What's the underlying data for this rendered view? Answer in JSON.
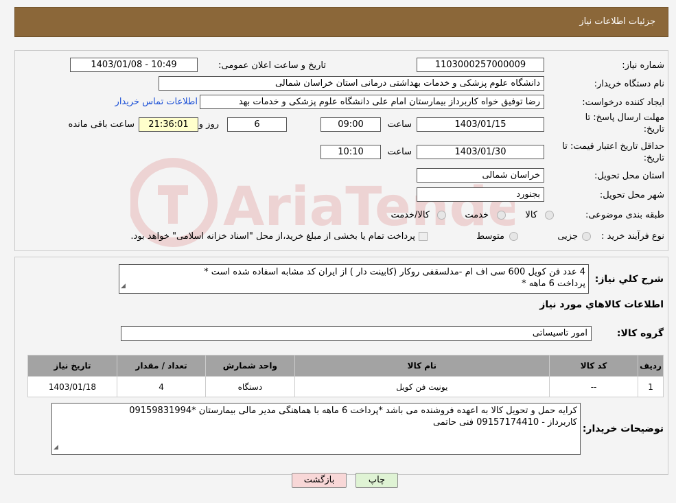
{
  "header": {
    "title": "جزئیات اطلاعات نیاز"
  },
  "form": {
    "need_number_label": "شماره نیاز:",
    "need_number": "1103000257000009",
    "announce_label": "تاریخ و ساعت اعلان عمومی:",
    "announce_value": "1403/01/08 - 10:49",
    "buyer_label": "نام دستگاه خریدار:",
    "buyer_value": "دانشگاه علوم پزشکی و خدمات بهداشتی درمانی استان خراسان شمالی",
    "creator_label": "ایجاد کننده درخواست:",
    "creator_value": "رضا توفیق خواه کاربرداز بیمارستان امام علی دانشگاه علوم پزشکی و خدمات بهد",
    "contact_link": "اطلاعات تماس خریدار",
    "deadline_label_1": "مهلت ارسال پاسخ: تا",
    "deadline_label_2": "تاریخ:",
    "deadline_date": "1403/01/15",
    "time_label": "ساعت",
    "deadline_time": "09:00",
    "days_value": "6",
    "days_label": "روز و",
    "remaining_time": "21:36:01",
    "remaining_label": "ساعت باقی مانده",
    "validity_label_1": "حداقل تاریخ اعتبار قیمت: تا",
    "validity_label_2": "تاریخ:",
    "validity_date": "1403/01/30",
    "validity_time": "10:10",
    "province_label": "استان محل تحویل:",
    "province_value": "خراسان شمالی",
    "city_label": "شهر محل تحویل:",
    "city_value": "بجنورد",
    "category_label": "طبقه بندی موضوعی:",
    "category_options": [
      "کالا",
      "خدمت",
      "کالا/خدمت"
    ],
    "process_label": "نوع فرآیند خرید :",
    "process_options": [
      "جزیی",
      "متوسط"
    ],
    "process_note": "پرداخت تمام یا بخشی از مبلغ خرید،از محل \"اسناد خزانه اسلامی\" خواهد بود."
  },
  "summary": {
    "label": "شرح کلي نياز:",
    "line1": "4 عدد فن کویل 600 سی اف ام -مدلسقفی روکار (کابینت دار ) از ایران کد مشابه اسفاده شده است *",
    "line2": "پرداخت 6  ماهه *"
  },
  "items_section": {
    "title": "اطلاعات کالاهاي مورد نياز",
    "group_label": "گروه کالا:",
    "group_value": "امور تاسیساتی",
    "headers": [
      "ردیف",
      "کد کالا",
      "نام کالا",
      "واحد شمارش",
      "تعداد / مقدار",
      "تاریخ نیاز"
    ],
    "rows": [
      [
        "1",
        "--",
        "یونیت فن کویل",
        "دستگاه",
        "4",
        "1403/01/18"
      ]
    ]
  },
  "notes": {
    "label": "توضیحات خریدار:",
    "line1": "کرایه حمل و تحویل کالا به اعهده فروشنده می باشد  *پرداخت 6 ماهه  با هماهنگی مدیر مالی بیمارستان  *09159831994",
    "line2": "کاربرداز - 09157174410 فنی حاتمی"
  },
  "buttons": {
    "print": "چاپ",
    "back": "بازگشت"
  },
  "watermark": {
    "text": "AriaTender.neT"
  },
  "colors": {
    "header_bg": "#8b6739",
    "link": "#1a4fd6",
    "back_button_bg": "#f8d7d7",
    "print_button_bg": "#dff3d4"
  }
}
